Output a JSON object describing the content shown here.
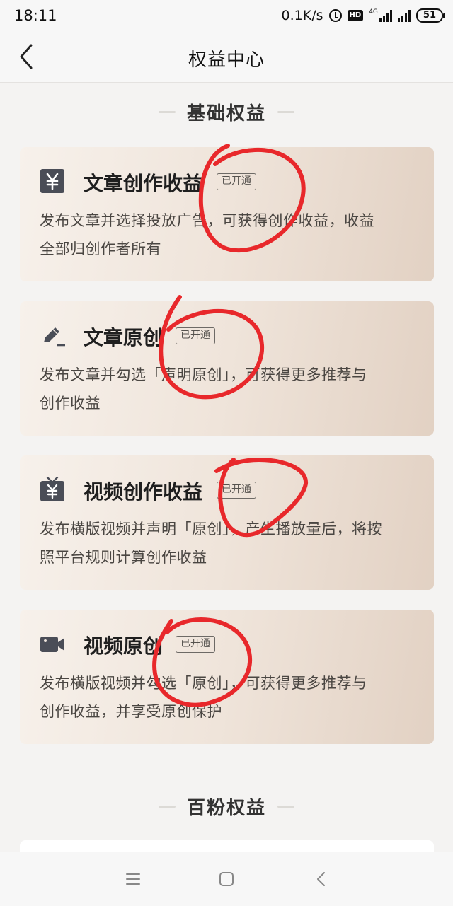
{
  "status_bar": {
    "time": "18:11",
    "speed": "0.1K/s",
    "hd": "HD",
    "network": "4G",
    "battery": "51"
  },
  "nav": {
    "title": "权益中心",
    "back_icon": "chevron-left-icon"
  },
  "sections": {
    "basic": "基础权益",
    "hundred_fans": "百粉权益"
  },
  "cards": [
    {
      "icon": "yen-icon",
      "title": "文章创作收益",
      "badge": "已开通",
      "desc_line1": "发布文章并选择投放广告，可获得创作收益，收益",
      "desc_line2": "全部归创作者所有"
    },
    {
      "icon": "pencil-icon",
      "title": "文章原创",
      "badge": "已开通",
      "desc_line1": "发布文章并勾选「声明原创」，可获得更多推荐与",
      "desc_line2": "创作收益"
    },
    {
      "icon": "tv-yen-icon",
      "title": "视频创作收益",
      "badge": "已开通",
      "desc_line1": "发布横版视频并声明「原创」，产生播放量后，将按",
      "desc_line2": "照平台规则计算创作收益"
    },
    {
      "icon": "video-camera-icon",
      "title": "视频原创",
      "badge": "已开通",
      "desc_line1": "发布横版视频并勾选「原创」，可获得更多推荐与",
      "desc_line2": "创作收益，并享受原创保护"
    }
  ],
  "bottom_nav": {
    "menu_icon": "menu-icon",
    "home_icon": "home-square-icon",
    "back_icon": "back-chevron-icon"
  },
  "colors": {
    "annotation": "#e8282b",
    "card_gradient_start": "#f7f1eb",
    "card_gradient_end": "#e2d1c3"
  }
}
